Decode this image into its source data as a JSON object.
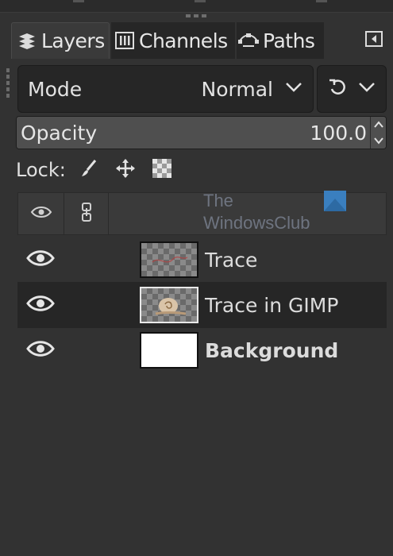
{
  "tabs": [
    {
      "label": "Layers",
      "icon": "layers-icon",
      "active": true
    },
    {
      "label": "Channels",
      "icon": "channels-icon",
      "active": false
    },
    {
      "label": "Paths",
      "icon": "paths-icon",
      "active": false
    }
  ],
  "mode": {
    "label": "Mode",
    "value": "Normal"
  },
  "opacity": {
    "label": "Opacity",
    "value": "100.0",
    "fraction": 1.0
  },
  "lock": {
    "label": "Lock:",
    "items": [
      "lock-pixels-icon",
      "lock-position-icon",
      "lock-alpha-icon"
    ]
  },
  "watermark": {
    "line1": "The",
    "line2": "WindowsClub"
  },
  "layers": [
    {
      "name": "Trace",
      "visible": true,
      "selected": false,
      "bold": false,
      "thumb": "transparent"
    },
    {
      "name": "Trace in GIMP",
      "visible": true,
      "selected": true,
      "bold": false,
      "thumb": "snail"
    },
    {
      "name": "Background",
      "visible": true,
      "selected": false,
      "bold": true,
      "thumb": "white"
    }
  ],
  "colors": {
    "panel": "#323232",
    "selected_row": "#262626",
    "text": "#dcdcdc",
    "watermark_logo": "#3a7fbf"
  }
}
